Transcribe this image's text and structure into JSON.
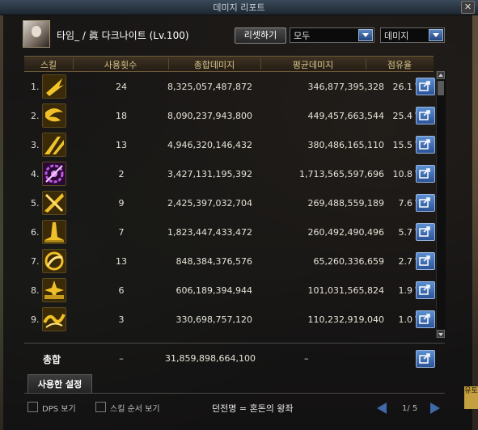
{
  "window": {
    "title": "데미지 리포트",
    "close": "✕"
  },
  "character": {
    "name": "타임_ / 眞 다크나이트 (Lv.100)"
  },
  "controls": {
    "reset_label": "리셋하기",
    "filter_value": "모두",
    "metric_value": "데미지"
  },
  "table": {
    "headers": {
      "skill": "스킬",
      "count": "사용횟수",
      "total": "총합데미지",
      "avg": "평균데미지",
      "share": "점유율"
    },
    "rows": [
      {
        "rank": "1.",
        "icon": "skill-icon-gold-dash",
        "count": "24",
        "total": "8,325,057,487,872",
        "avg": "346,877,395,328",
        "share": "26.1",
        "pct": "%"
      },
      {
        "rank": "2.",
        "icon": "skill-icon-gold-swirl",
        "count": "18",
        "total": "8,090,237,943,800",
        "avg": "449,457,663,544",
        "share": "25.4",
        "pct": "%"
      },
      {
        "rank": "3.",
        "icon": "skill-icon-gold-slash",
        "count": "13",
        "total": "4,946,320,146,432",
        "avg": "380,486,165,110",
        "share": "15.5",
        "pct": "%"
      },
      {
        "rank": "4.",
        "icon": "skill-icon-purple-gear",
        "count": "2",
        "total": "3,427,131,195,392",
        "avg": "1,713,565,597,696",
        "share": "10.8",
        "pct": "%"
      },
      {
        "rank": "5.",
        "icon": "skill-icon-gold-cross-slash",
        "count": "9",
        "total": "2,425,397,032,704",
        "avg": "269,488,559,189",
        "share": "7.6",
        "pct": "%"
      },
      {
        "rank": "6.",
        "icon": "skill-icon-gold-pillar",
        "count": "7",
        "total": "1,823,447,433,472",
        "avg": "260,492,490,496",
        "share": "5.7",
        "pct": "%"
      },
      {
        "rank": "7.",
        "icon": "skill-icon-gold-vortex",
        "count": "13",
        "total": "848,384,376,576",
        "avg": "65,260,336,659",
        "share": "2.7",
        "pct": "%"
      },
      {
        "rank": "8.",
        "icon": "skill-icon-gold-burst",
        "count": "6",
        "total": "606,189,394,944",
        "avg": "101,031,565,824",
        "share": "1.9",
        "pct": "%"
      },
      {
        "rank": "9.",
        "icon": "skill-icon-gold-wave",
        "count": "3",
        "total": "330,698,757,120",
        "avg": "110,232,919,040",
        "share": "1.0",
        "pct": "%"
      }
    ]
  },
  "totals": {
    "label": "총합",
    "count": "–",
    "total": "31,859,898,664,100",
    "avg": "–"
  },
  "settings": {
    "tab_label": "사용한 설정",
    "dps_label": "DPS 보기",
    "skill_order_label": "스킬 순서 보기",
    "dungeon_text": "던전명 = 혼돈의 왕좌"
  },
  "pagination": {
    "text": "1/ 5"
  },
  "side_tab": {
    "text": "유토"
  },
  "colors": {
    "accent_blue": "#2b5398",
    "header_gold": "#d8c48c",
    "skill_gold": "#e8b820",
    "skill_purple": "#b04cd8"
  }
}
